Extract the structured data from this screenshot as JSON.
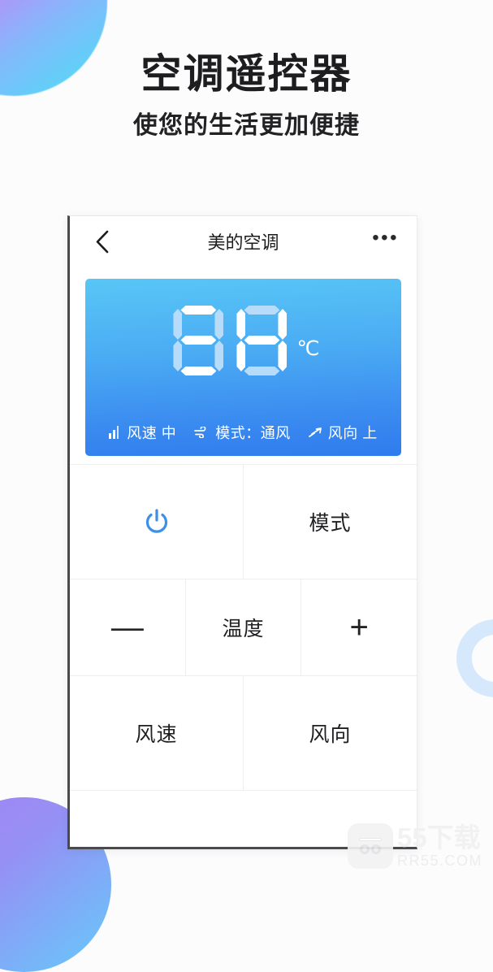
{
  "page": {
    "headline": "空调遥控器",
    "subheadline": "使您的生活更加便捷",
    "background_color": "#fcfcfd"
  },
  "decor": {
    "top_left_blob": "gradient-blob-magenta-cyan",
    "bottom_left_blob": "gradient-blob-purple-blue",
    "right_ring": "light-blue-ring"
  },
  "phone": {
    "nav": {
      "back_icon": "chevron-left-icon",
      "title": "美的空调",
      "more_label": "•••"
    },
    "display": {
      "digit_one": "8",
      "digit_two": "8",
      "unit": "℃",
      "accent_bright": "#ffffff",
      "accent_dim": "#b6dcfa",
      "gradient_top": "#58c6f6",
      "gradient_bottom": "#2f7bee",
      "status": [
        {
          "icon": "signal-bars-icon",
          "text": "风速 中"
        },
        {
          "icon": "fan-wind-icon",
          "text": "模式：通风"
        },
        {
          "icon": "wind-direction-arrow-icon",
          "text": "风向 上"
        }
      ]
    },
    "buttons": {
      "power": {
        "icon": "power-icon",
        "color": "#3d8fe8"
      },
      "mode": "模式",
      "temperature": {
        "decrease": "—",
        "label": "温度",
        "increase": "+"
      },
      "fan_speed": "风速",
      "wind_direction": "风向"
    }
  },
  "watermark": {
    "logo": "55-logo-icon",
    "title": "55下载",
    "url": "RR55.COM"
  }
}
